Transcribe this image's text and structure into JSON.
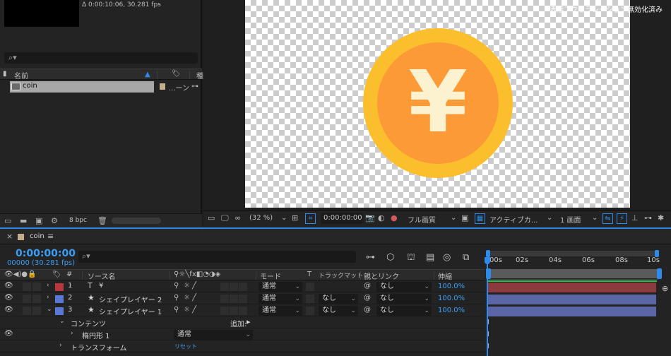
{
  "project": {
    "info": "Δ 0:00:10:06, 30.281 fps",
    "search_icon": "⌕▾",
    "col_name": "名前",
    "col_type": "...ーン",
    "row_name": "coin",
    "bpc": "8 bpc"
  },
  "viewer": {
    "accel_notice": "表示アクセラレーション無効化済み",
    "coin_symbol": "¥",
    "zoom": "(32 %)",
    "timecode": "0:00:00:00",
    "resolution": "フル画質",
    "camera": "アクティブカ...",
    "views": "1 画面",
    "coin_colors": {
      "outer": "#fbbf2e",
      "inner": "#fb9a36",
      "glyph": "#fdf2cf"
    }
  },
  "timeline": {
    "tab_name": "coin",
    "timecode": "0:00:00:00",
    "frames": "00000 (30.281 fps)",
    "columns": {
      "source_name": "ソース名",
      "mode": "モード",
      "t": "T",
      "track_matte": "トラックマット",
      "parent": "親とリンク",
      "stretch": "伸縮"
    },
    "layers": [
      {
        "num": "1",
        "type_icon": "T",
        "name": "¥",
        "color": "#b8383d",
        "mode": "通常",
        "matte": "",
        "parent": "なし",
        "stretch": "100.0%",
        "bar_color": "#8b3a3e",
        "expanded": false
      },
      {
        "num": "2",
        "type_icon": "★",
        "name": "シェイプレイヤー 2",
        "color": "#5b78d8",
        "mode": "通常",
        "matte": "なし",
        "parent": "なし",
        "stretch": "100.0%",
        "bar_color": "#5a66a6",
        "expanded": false
      },
      {
        "num": "3",
        "type_icon": "★",
        "name": "シェイプレイヤー 1",
        "color": "#5b78d8",
        "mode": "通常",
        "matte": "なし",
        "parent": "なし",
        "stretch": "100.0%",
        "bar_color": "#5a66a6",
        "expanded": true
      }
    ],
    "contents_label": "コンテンツ",
    "add_label": "追加:",
    "ellipse_label": "楕円形 1",
    "ellipse_mode": "通常",
    "transform_label": "トランスフォーム",
    "reset_label": "リセット",
    "ruler_ticks": [
      "00s",
      "02s",
      "04s",
      "06s",
      "08s",
      "10s"
    ]
  }
}
